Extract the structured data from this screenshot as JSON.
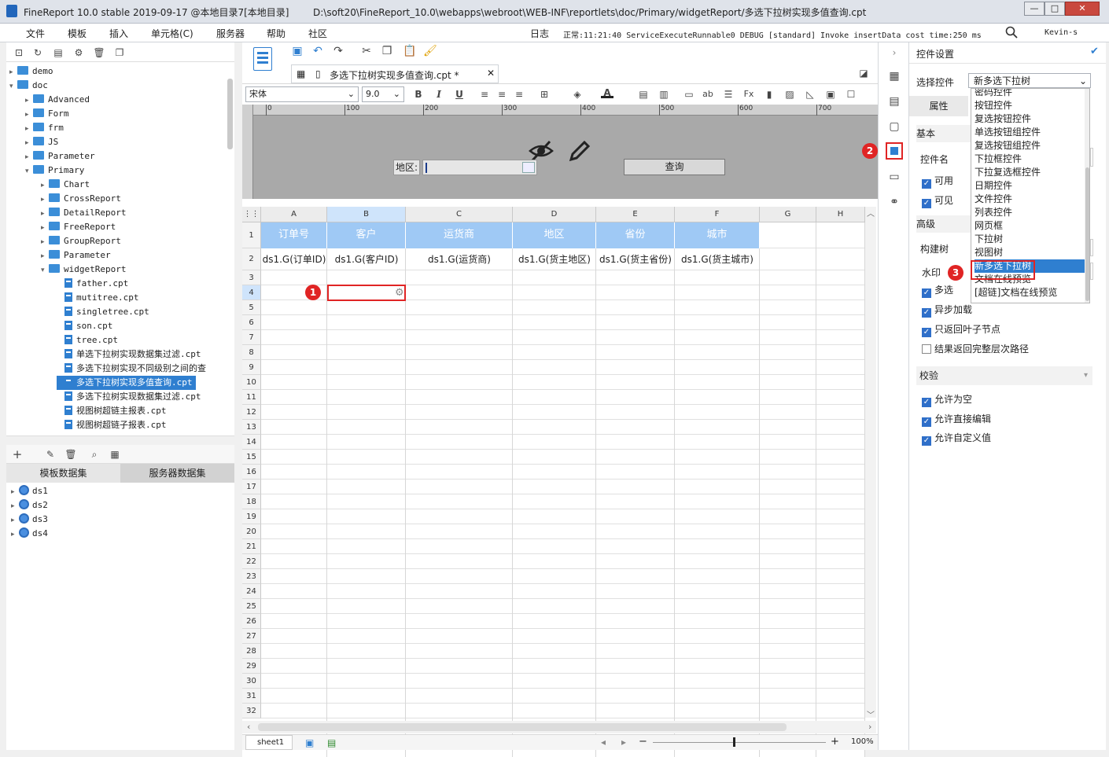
{
  "app": {
    "title": "FineReport 10.0 stable 2019-09-17 @本地目录7[本地目录]",
    "path": "D:\\soft20\\FineReport_10.0\\webapps\\webroot\\WEB-INF\\reportlets\\doc/Primary/widgetReport/多选下拉树实现多值查询.cpt",
    "min": "—",
    "max": "□",
    "close": "✕"
  },
  "menu": {
    "items": [
      "文件",
      "模板",
      "插入",
      "单元格(C)",
      "服务器",
      "帮助",
      "社区"
    ],
    "log": "日志",
    "status": "正常:11:21:40 ServiceExecuteRunnable0 DEBUG [standard] Invoke insertData cost time:250 ms",
    "user": "Kevin-s"
  },
  "tree": {
    "items": [
      {
        "label": "demo"
      },
      {
        "label": "doc"
      },
      {
        "label": "Advanced"
      },
      {
        "label": "Form"
      },
      {
        "label": "frm"
      },
      {
        "label": "JS"
      },
      {
        "label": "Parameter"
      },
      {
        "label": "Primary"
      },
      {
        "label": "Chart"
      },
      {
        "label": "CrossReport"
      },
      {
        "label": "DetailReport"
      },
      {
        "label": "FreeReport"
      },
      {
        "label": "GroupReport"
      },
      {
        "label": "Parameter"
      },
      {
        "label": "widgetReport"
      },
      {
        "label": "father.cpt"
      },
      {
        "label": "mutitree.cpt"
      },
      {
        "label": "singletree.cpt"
      },
      {
        "label": "son.cpt"
      },
      {
        "label": "tree.cpt"
      },
      {
        "label": "单选下拉树实现数据集过滤.cpt"
      },
      {
        "label": "多选下拉树实现不同级别之间的查"
      },
      {
        "label": "多选下拉树实现多值查询.cpt"
      },
      {
        "label": "多选下拉树实现数据集过滤.cpt"
      },
      {
        "label": "视图树超链主报表.cpt"
      },
      {
        "label": "视图树超链子报表.cpt"
      }
    ]
  },
  "dataset": {
    "tab1": "模板数据集",
    "tab2": "服务器数据集",
    "items": [
      "ds1",
      "ds2",
      "ds3",
      "ds4"
    ]
  },
  "editor": {
    "tab_title": "多选下拉树实现多值查询.cpt *",
    "font": "宋体",
    "font_size": "9.0",
    "bold": "B",
    "italic": "I",
    "underline": "U",
    "ruler": [
      "0",
      "100",
      "200",
      "300",
      "400",
      "500",
      "600",
      "700"
    ],
    "param_label": "地区:",
    "query_button": "查询",
    "columns": [
      "A",
      "B",
      "C",
      "D",
      "E",
      "F",
      "G",
      "H"
    ],
    "header_row": [
      "订单号",
      "客户",
      "运货商",
      "地区",
      "省份",
      "城市"
    ],
    "data_row": [
      "ds1.G(订单ID)",
      "ds1.G(客户ID)",
      "ds1.G(运货商)",
      "ds1.G(货主地区)",
      "ds1.G(货主省份)",
      "ds1.G(货主城市)"
    ],
    "row_numbers": [
      "1 (H)",
      "2",
      "3",
      "4",
      "5",
      "6",
      "7",
      "8",
      "9",
      "10",
      "11",
      "12",
      "13",
      "14",
      "15",
      "16",
      "17",
      "18",
      "19",
      "20",
      "21",
      "22",
      "23",
      "24",
      "25",
      "26",
      "27",
      "28",
      "29",
      "30",
      "31",
      "32"
    ],
    "sheet": "sheet1",
    "zoom": "100%"
  },
  "props": {
    "title": "控件设置",
    "select_label": "选择控件",
    "selected_widget": "新多选下拉树",
    "tab_attr": "属性",
    "basic": "基本",
    "widget_name": "控件名",
    "enabled": "可用",
    "visible": "可见",
    "advanced": "高级",
    "build_tree": "构建树",
    "watermark": "水印",
    "multi": "多选",
    "async": "异步加载",
    "leaf_only": "只返回叶子节点",
    "full_path": "结果返回完整层次路径",
    "validate": "校验",
    "allow_empty": "允许为空",
    "allow_edit": "允许直接编辑",
    "allow_custom": "允许自定义值",
    "options": [
      "密码控件",
      "按钮控件",
      "复选按钮控件",
      "单选按钮组控件",
      "复选按钮组控件",
      "下拉框控件",
      "下拉复选框控件",
      "日期控件",
      "文件控件",
      "列表控件",
      "网页框",
      "下拉树",
      "视图树",
      "新多选下拉树",
      "文档在线预览",
      "[超链]文档在线预览"
    ]
  },
  "badges": [
    "1",
    "2",
    "3"
  ]
}
